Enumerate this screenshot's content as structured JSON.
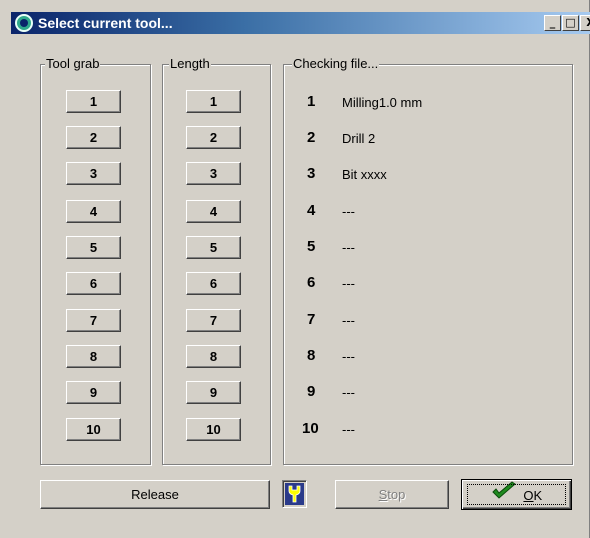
{
  "window": {
    "title": "Select current tool...",
    "controls": {
      "minimize": "_",
      "maximize": "□",
      "close": "X"
    }
  },
  "groups": {
    "tool_grab": {
      "legend": "Tool grab",
      "buttons": [
        "1",
        "2",
        "3",
        "4",
        "5",
        "6",
        "7",
        "8",
        "9",
        "10"
      ]
    },
    "length": {
      "legend": "Length",
      "buttons": [
        "1",
        "2",
        "3",
        "4",
        "5",
        "6",
        "7",
        "8",
        "9",
        "10"
      ]
    },
    "checking": {
      "legend": "Checking file...",
      "rows": [
        {
          "num": "1",
          "label": "Milling1.0 mm"
        },
        {
          "num": "2",
          "label": "Drill 2"
        },
        {
          "num": "3",
          "label": "Bit xxxx"
        },
        {
          "num": "4",
          "label": "---"
        },
        {
          "num": "5",
          "label": "---"
        },
        {
          "num": "6",
          "label": "---"
        },
        {
          "num": "7",
          "label": "---"
        },
        {
          "num": "8",
          "label": "---"
        },
        {
          "num": "9",
          "label": "---"
        },
        {
          "num": "10",
          "label": "---"
        }
      ]
    }
  },
  "footer": {
    "release_label": "Release",
    "wrench_icon": "wrench-icon",
    "stop_mnemonic": "S",
    "stop_rest": "top",
    "stop_enabled": false,
    "ok_mnemonic": "O",
    "ok_rest": "K",
    "check_icon": "checkmark-icon",
    "colors": {
      "check": "#1f8a1f",
      "wrench": "#2a3a8a",
      "title_start": "#0a246a"
    }
  }
}
